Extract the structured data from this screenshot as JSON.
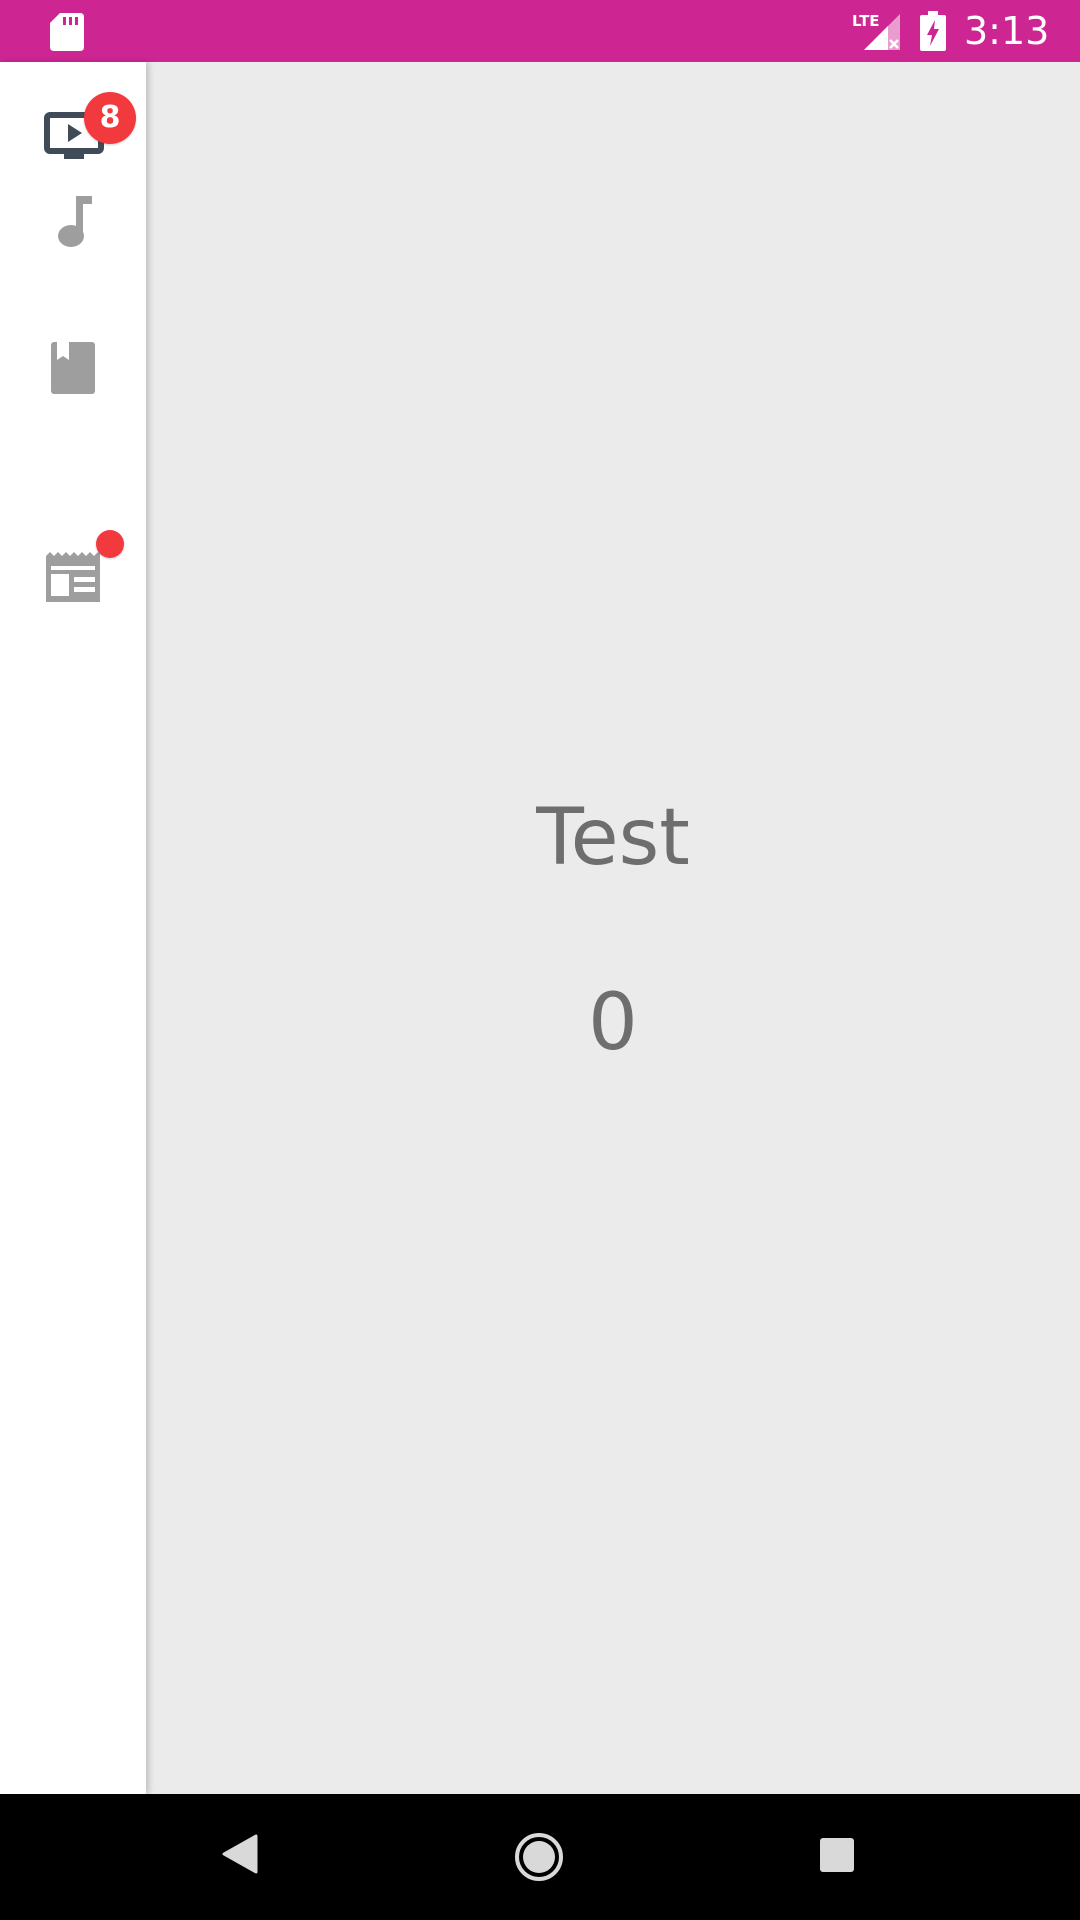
{
  "status_bar": {
    "time": "3:13",
    "network": "LTE",
    "color": "#cd2693",
    "icons": [
      "sd-card-icon",
      "lte-signal-icon",
      "battery-charging-icon"
    ]
  },
  "side_nav": {
    "items": [
      {
        "name": "video",
        "icon": "tv-play-icon",
        "badge": "8",
        "active": true
      },
      {
        "name": "music",
        "icon": "music-note-icon",
        "badge": "",
        "active": false
      },
      {
        "name": "books",
        "icon": "book-icon",
        "badge": "",
        "active": false
      },
      {
        "name": "news",
        "icon": "newspaper-icon",
        "badge_dot": true,
        "active": false
      }
    ],
    "badge_color": "#f23a3e"
  },
  "main": {
    "title": "Test",
    "count": "0"
  },
  "nav_bar": {
    "buttons": [
      "back-icon",
      "home-icon",
      "recents-icon"
    ]
  }
}
